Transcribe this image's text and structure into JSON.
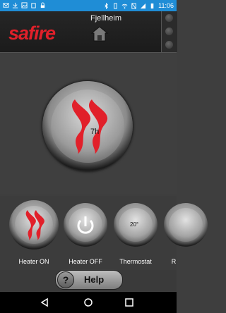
{
  "status": {
    "time": "11:06",
    "battery": ""
  },
  "header": {
    "brand": "safire",
    "location": "Fjellheim"
  },
  "dial": {
    "time_label": "7h"
  },
  "buttons": [
    {
      "label": "Heater ON"
    },
    {
      "label": "Heater OFF"
    },
    {
      "label": "Thermostat",
      "value": "20°"
    },
    {
      "label": "R"
    }
  ],
  "help": {
    "label": "Help",
    "symbol": "?"
  },
  "colors": {
    "brand_red": "#e1202a",
    "status_bar": "#1f8dd6"
  }
}
